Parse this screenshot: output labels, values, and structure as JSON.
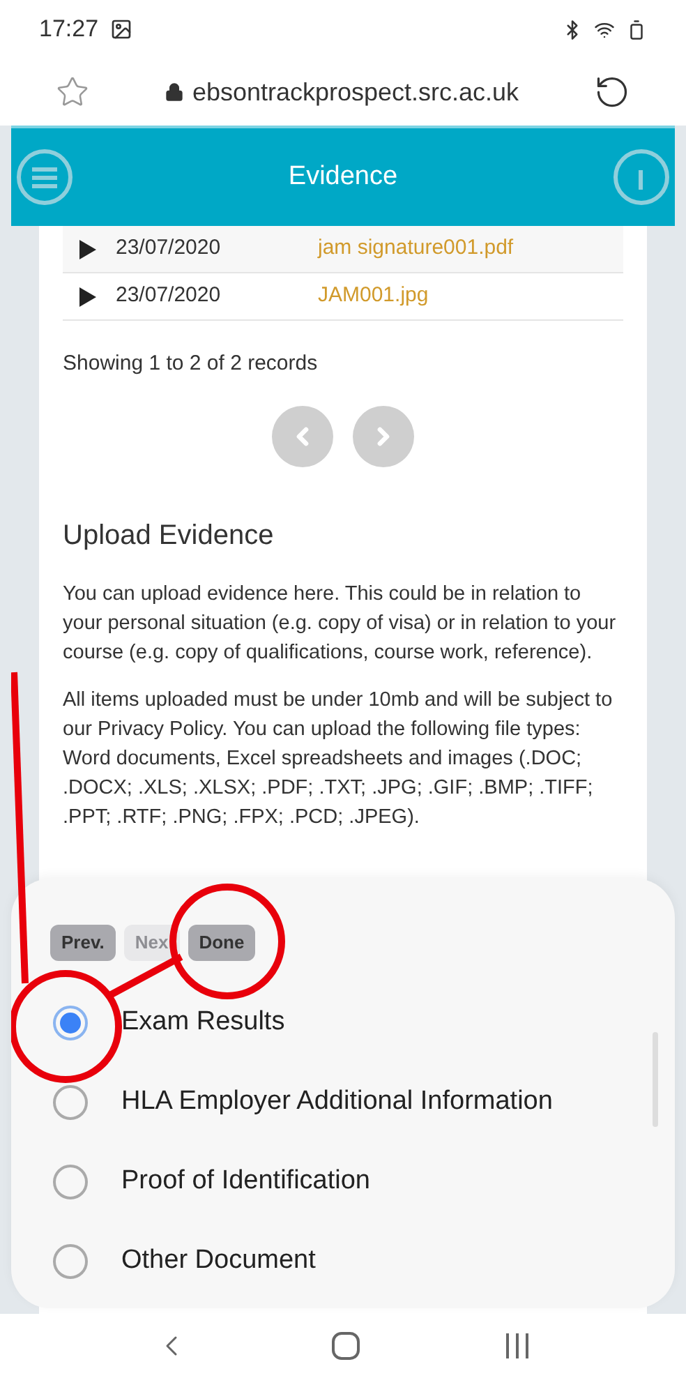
{
  "status_bar": {
    "time": "17:27"
  },
  "browser": {
    "url": "ebsontrackprospect.src.ac.uk"
  },
  "header": {
    "title": "Evidence"
  },
  "records": [
    {
      "date": "23/07/2020",
      "file": "jam signature001.pdf"
    },
    {
      "date": "23/07/2020",
      "file": "JAM001.jpg"
    }
  ],
  "records_summary": "Showing 1 to 2 of 2 records",
  "upload": {
    "heading": "Upload Evidence",
    "paragraphs": [
      "You can upload evidence here.  This could be in relation to your personal situation (e.g. copy of visa) or in relation to your course (e.g. copy of qualifications, course work, reference).",
      "All items uploaded must be under 10mb and will be subject to our Privacy Policy. You can upload the following file types:",
      "Word documents, Excel spreadsheets and images (.DOC; .DOCX; .XLS; .XLSX; .PDF; .TXT; .JPG; .GIF; .BMP; .TIFF; .PPT; .RTF; .PNG; .FPX; .PCD; .JPEG)."
    ]
  },
  "picker": {
    "buttons": [
      {
        "label": "Prev.",
        "disabled": false
      },
      {
        "label": "Nex",
        "disabled": true
      },
      {
        "label": "Done",
        "disabled": false
      }
    ],
    "options": [
      {
        "label": "Exam Results",
        "selected": true
      },
      {
        "label": "HLA Employer Additional Information",
        "selected": false
      },
      {
        "label": "Proof of Identification",
        "selected": false
      },
      {
        "label": "Other Document",
        "selected": false
      }
    ]
  }
}
